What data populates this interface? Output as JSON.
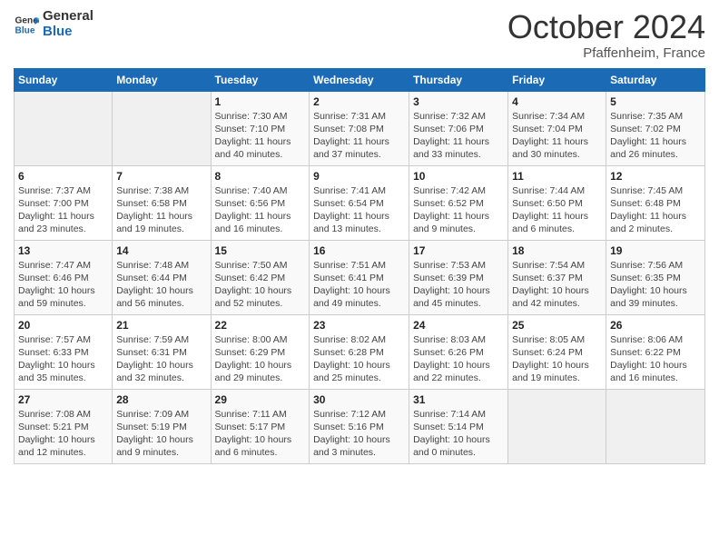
{
  "header": {
    "logo_line1": "General",
    "logo_line2": "Blue",
    "month": "October 2024",
    "location": "Pfaffenheim, France"
  },
  "days_of_week": [
    "Sunday",
    "Monday",
    "Tuesday",
    "Wednesday",
    "Thursday",
    "Friday",
    "Saturday"
  ],
  "weeks": [
    [
      {
        "day": "",
        "info": ""
      },
      {
        "day": "",
        "info": ""
      },
      {
        "day": "1",
        "info": "Sunrise: 7:30 AM\nSunset: 7:10 PM\nDaylight: 11 hours and 40 minutes."
      },
      {
        "day": "2",
        "info": "Sunrise: 7:31 AM\nSunset: 7:08 PM\nDaylight: 11 hours and 37 minutes."
      },
      {
        "day": "3",
        "info": "Sunrise: 7:32 AM\nSunset: 7:06 PM\nDaylight: 11 hours and 33 minutes."
      },
      {
        "day": "4",
        "info": "Sunrise: 7:34 AM\nSunset: 7:04 PM\nDaylight: 11 hours and 30 minutes."
      },
      {
        "day": "5",
        "info": "Sunrise: 7:35 AM\nSunset: 7:02 PM\nDaylight: 11 hours and 26 minutes."
      }
    ],
    [
      {
        "day": "6",
        "info": "Sunrise: 7:37 AM\nSunset: 7:00 PM\nDaylight: 11 hours and 23 minutes."
      },
      {
        "day": "7",
        "info": "Sunrise: 7:38 AM\nSunset: 6:58 PM\nDaylight: 11 hours and 19 minutes."
      },
      {
        "day": "8",
        "info": "Sunrise: 7:40 AM\nSunset: 6:56 PM\nDaylight: 11 hours and 16 minutes."
      },
      {
        "day": "9",
        "info": "Sunrise: 7:41 AM\nSunset: 6:54 PM\nDaylight: 11 hours and 13 minutes."
      },
      {
        "day": "10",
        "info": "Sunrise: 7:42 AM\nSunset: 6:52 PM\nDaylight: 11 hours and 9 minutes."
      },
      {
        "day": "11",
        "info": "Sunrise: 7:44 AM\nSunset: 6:50 PM\nDaylight: 11 hours and 6 minutes."
      },
      {
        "day": "12",
        "info": "Sunrise: 7:45 AM\nSunset: 6:48 PM\nDaylight: 11 hours and 2 minutes."
      }
    ],
    [
      {
        "day": "13",
        "info": "Sunrise: 7:47 AM\nSunset: 6:46 PM\nDaylight: 10 hours and 59 minutes."
      },
      {
        "day": "14",
        "info": "Sunrise: 7:48 AM\nSunset: 6:44 PM\nDaylight: 10 hours and 56 minutes."
      },
      {
        "day": "15",
        "info": "Sunrise: 7:50 AM\nSunset: 6:42 PM\nDaylight: 10 hours and 52 minutes."
      },
      {
        "day": "16",
        "info": "Sunrise: 7:51 AM\nSunset: 6:41 PM\nDaylight: 10 hours and 49 minutes."
      },
      {
        "day": "17",
        "info": "Sunrise: 7:53 AM\nSunset: 6:39 PM\nDaylight: 10 hours and 45 minutes."
      },
      {
        "day": "18",
        "info": "Sunrise: 7:54 AM\nSunset: 6:37 PM\nDaylight: 10 hours and 42 minutes."
      },
      {
        "day": "19",
        "info": "Sunrise: 7:56 AM\nSunset: 6:35 PM\nDaylight: 10 hours and 39 minutes."
      }
    ],
    [
      {
        "day": "20",
        "info": "Sunrise: 7:57 AM\nSunset: 6:33 PM\nDaylight: 10 hours and 35 minutes."
      },
      {
        "day": "21",
        "info": "Sunrise: 7:59 AM\nSunset: 6:31 PM\nDaylight: 10 hours and 32 minutes."
      },
      {
        "day": "22",
        "info": "Sunrise: 8:00 AM\nSunset: 6:29 PM\nDaylight: 10 hours and 29 minutes."
      },
      {
        "day": "23",
        "info": "Sunrise: 8:02 AM\nSunset: 6:28 PM\nDaylight: 10 hours and 25 minutes."
      },
      {
        "day": "24",
        "info": "Sunrise: 8:03 AM\nSunset: 6:26 PM\nDaylight: 10 hours and 22 minutes."
      },
      {
        "day": "25",
        "info": "Sunrise: 8:05 AM\nSunset: 6:24 PM\nDaylight: 10 hours and 19 minutes."
      },
      {
        "day": "26",
        "info": "Sunrise: 8:06 AM\nSunset: 6:22 PM\nDaylight: 10 hours and 16 minutes."
      }
    ],
    [
      {
        "day": "27",
        "info": "Sunrise: 7:08 AM\nSunset: 5:21 PM\nDaylight: 10 hours and 12 minutes."
      },
      {
        "day": "28",
        "info": "Sunrise: 7:09 AM\nSunset: 5:19 PM\nDaylight: 10 hours and 9 minutes."
      },
      {
        "day": "29",
        "info": "Sunrise: 7:11 AM\nSunset: 5:17 PM\nDaylight: 10 hours and 6 minutes."
      },
      {
        "day": "30",
        "info": "Sunrise: 7:12 AM\nSunset: 5:16 PM\nDaylight: 10 hours and 3 minutes."
      },
      {
        "day": "31",
        "info": "Sunrise: 7:14 AM\nSunset: 5:14 PM\nDaylight: 10 hours and 0 minutes."
      },
      {
        "day": "",
        "info": ""
      },
      {
        "day": "",
        "info": ""
      }
    ]
  ]
}
